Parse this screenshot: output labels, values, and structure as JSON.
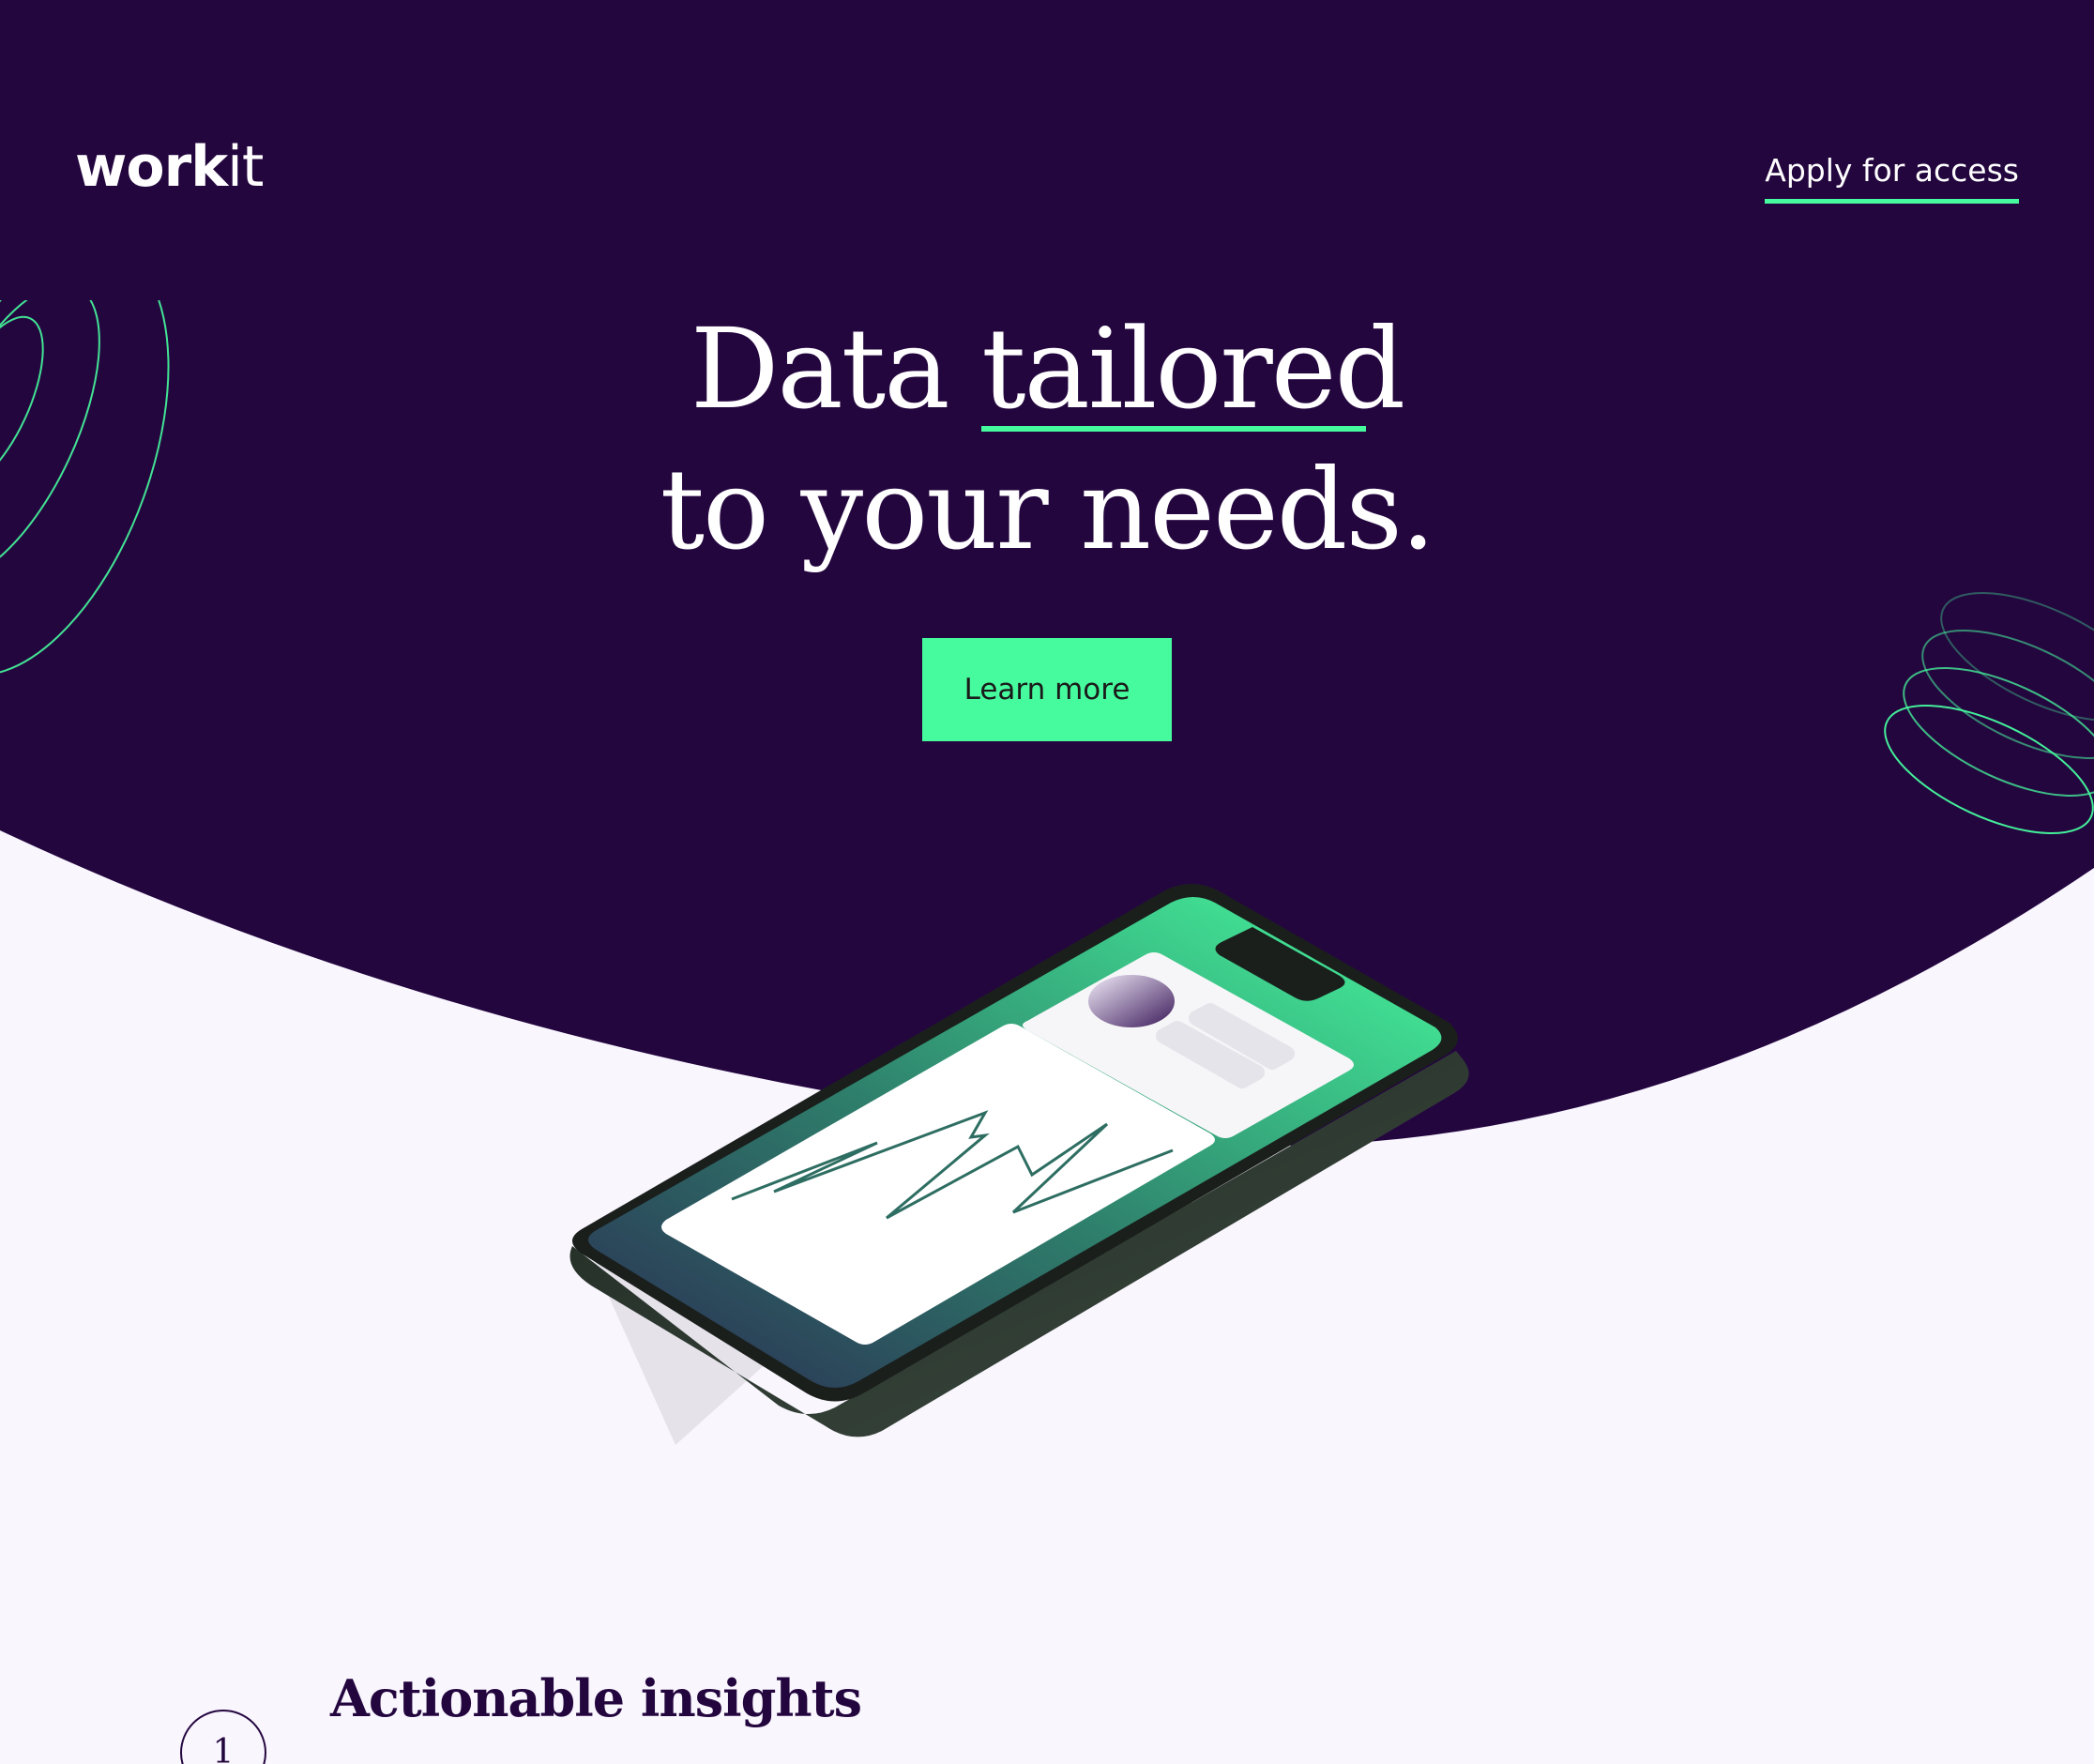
{
  "header": {
    "logo_bold": "work",
    "logo_light": "it",
    "nav_link": "Apply for access"
  },
  "hero": {
    "headline_word1": "Data",
    "headline_word2": "tailored",
    "headline_line2": "to your needs.",
    "cta_label": "Learn more"
  },
  "features": {
    "step_number": "1",
    "title": "Actionable insights"
  },
  "colors": {
    "hero_bg": "#24063f",
    "accent": "#46fb9e",
    "page_bg": "#f9f6fe",
    "text_light": "#ffffff",
    "text_dark": "#24063f"
  },
  "icons": {
    "decoration_left": "spiral-rings-icon",
    "decoration_right": "spiral-rings-icon",
    "phone_illustration": "smartphone-chart-illustration"
  }
}
